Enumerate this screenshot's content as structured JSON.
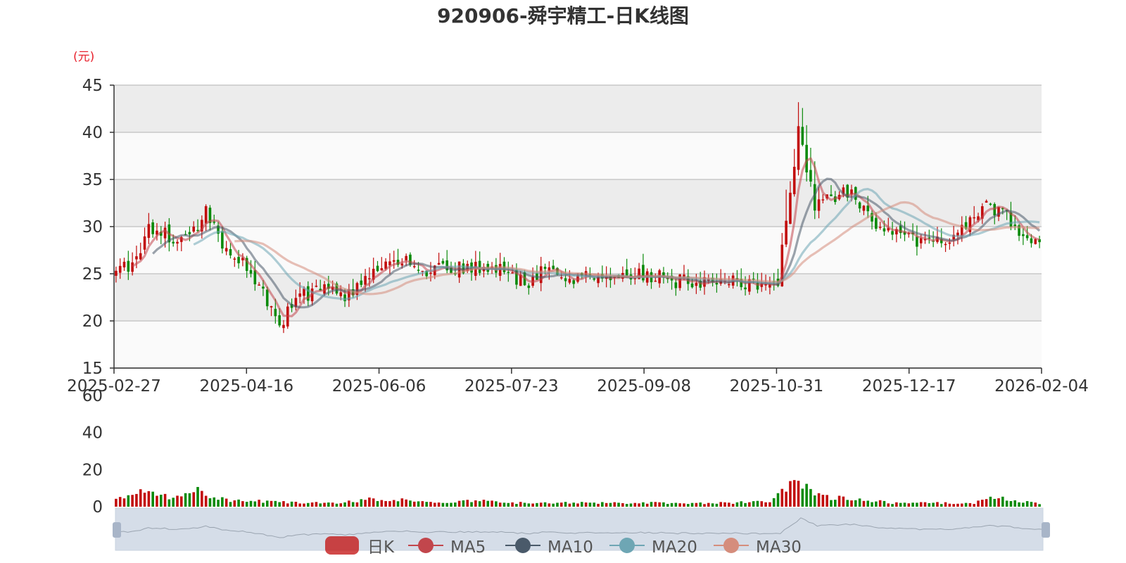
{
  "chart_data": {
    "type": "candlestick",
    "title": "920906-舜宇精工-日K线图",
    "unit_label": "(元)",
    "colors": {
      "up": "#c20c0c",
      "down": "#0a8a0a",
      "ma5": "#c2464c",
      "ma10": "#4a5a6a",
      "ma20": "#6ea6b4",
      "ma30": "#d58d7c"
    },
    "price_axis": {
      "ylim": [
        15,
        45
      ],
      "ticks": [
        15,
        20,
        25,
        30,
        35,
        40,
        45
      ],
      "grid": true
    },
    "volume_axis": {
      "ylim": [
        0,
        60
      ],
      "ticks": [
        0,
        20,
        40,
        60
      ]
    },
    "x_axis": {
      "date_labels": [
        "2025-02-27",
        "2025-04-16",
        "2025-06-06",
        "2025-07-23",
        "2025-09-08",
        "2025-10-31",
        "2025-12-17",
        "2026-02-04"
      ],
      "session_count": 227
    },
    "legend": [
      "日K",
      "MA5",
      "MA10",
      "MA20",
      "MA30"
    ],
    "close_anchors": [
      [
        0,
        26
      ],
      [
        4,
        26
      ],
      [
        8,
        29.5
      ],
      [
        14,
        29
      ],
      [
        18,
        29.2
      ],
      [
        22,
        31.5
      ],
      [
        26,
        28
      ],
      [
        30,
        26.5
      ],
      [
        35,
        24
      ],
      [
        38,
        21
      ],
      [
        40,
        19
      ],
      [
        44,
        22.5
      ],
      [
        48,
        23
      ],
      [
        52,
        23.5
      ],
      [
        56,
        22.5
      ],
      [
        60,
        23.5
      ],
      [
        64,
        25.5
      ],
      [
        68,
        26.5
      ],
      [
        72,
        26
      ],
      [
        76,
        25.5
      ],
      [
        80,
        26
      ],
      [
        84,
        25.5
      ],
      [
        88,
        25.5
      ],
      [
        92,
        26
      ],
      [
        96,
        25
      ],
      [
        100,
        24
      ],
      [
        104,
        25
      ],
      [
        108,
        24.8
      ],
      [
        112,
        24.5
      ],
      [
        118,
        24.6
      ],
      [
        124,
        24.8
      ],
      [
        130,
        25
      ],
      [
        136,
        24.2
      ],
      [
        142,
        24.3
      ],
      [
        148,
        24.2
      ],
      [
        155,
        24
      ],
      [
        162,
        24.3
      ],
      [
        163,
        28
      ],
      [
        165,
        34
      ],
      [
        167,
        40
      ],
      [
        169,
        36
      ],
      [
        171,
        32
      ],
      [
        173,
        33
      ],
      [
        176,
        33
      ],
      [
        178,
        33.5
      ],
      [
        180,
        34
      ],
      [
        182,
        32
      ],
      [
        184,
        31
      ],
      [
        186,
        30
      ],
      [
        190,
        29
      ],
      [
        194,
        28.8
      ],
      [
        198,
        28.5
      ],
      [
        202,
        28.8
      ],
      [
        206,
        29
      ],
      [
        210,
        31
      ],
      [
        212,
        32.5
      ],
      [
        214,
        32
      ],
      [
        218,
        31
      ],
      [
        220,
        30
      ],
      [
        224,
        29
      ],
      [
        227,
        27.5
      ]
    ],
    "volume_anchors": [
      [
        0,
        5
      ],
      [
        2,
        5
      ],
      [
        4,
        7
      ],
      [
        6,
        9
      ],
      [
        8,
        7
      ],
      [
        10,
        6
      ],
      [
        13,
        5
      ],
      [
        16,
        5
      ],
      [
        18,
        7
      ],
      [
        20,
        10
      ],
      [
        22,
        7
      ],
      [
        24,
        5
      ],
      [
        26,
        4
      ],
      [
        28,
        3
      ],
      [
        35,
        3
      ],
      [
        38,
        3
      ],
      [
        45,
        2
      ],
      [
        55,
        2
      ],
      [
        58,
        3
      ],
      [
        62,
        4
      ],
      [
        66,
        3
      ],
      [
        70,
        4
      ],
      [
        75,
        3
      ],
      [
        80,
        2
      ],
      [
        85,
        3
      ],
      [
        90,
        3
      ],
      [
        95,
        2
      ],
      [
        100,
        2
      ],
      [
        110,
        2
      ],
      [
        120,
        2
      ],
      [
        130,
        2
      ],
      [
        140,
        2
      ],
      [
        150,
        2
      ],
      [
        160,
        3
      ],
      [
        163,
        10
      ],
      [
        165,
        13
      ],
      [
        167,
        15
      ],
      [
        169,
        10
      ],
      [
        171,
        6
      ],
      [
        175,
        5
      ],
      [
        178,
        5
      ],
      [
        182,
        4
      ],
      [
        186,
        3
      ],
      [
        190,
        2
      ],
      [
        200,
        2
      ],
      [
        210,
        2
      ],
      [
        215,
        5
      ],
      [
        220,
        3
      ],
      [
        225,
        2
      ],
      [
        227,
        1
      ]
    ]
  }
}
